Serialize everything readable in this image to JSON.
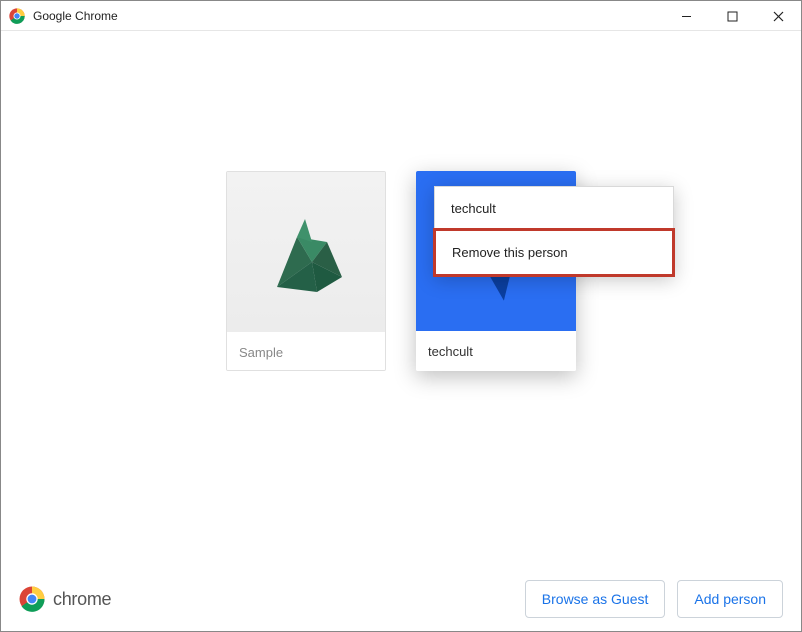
{
  "window": {
    "title": "Google Chrome"
  },
  "profiles": [
    {
      "name": "Sample",
      "selected": false,
      "art": "origami-green"
    },
    {
      "name": "techcult",
      "selected": true,
      "art": "blue-geo"
    }
  ],
  "context_menu": {
    "items": [
      {
        "label": "techcult",
        "highlighted": false
      },
      {
        "label": "Remove this person",
        "highlighted": true
      }
    ]
  },
  "brand": {
    "name": "chrome"
  },
  "buttons": {
    "browse_guest": "Browse as Guest",
    "add_person": "Add person"
  }
}
